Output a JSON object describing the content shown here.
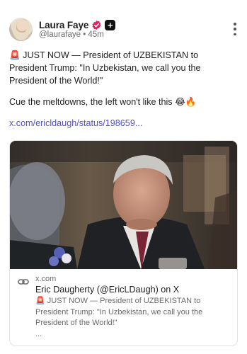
{
  "author": {
    "name": "Laura Faye",
    "handle": "@laurafaye",
    "separator": "•",
    "time": "45m"
  },
  "post": {
    "line1": "🚨 JUST NOW — President of UZBEKISTAN to President Trump: \"In Uzbekistan, we call you the President of the World!\"",
    "line2": "Cue the meltdowns, the left won't like this 😂🔥",
    "link": "x.com/ericldaugh/status/198659..."
  },
  "card": {
    "domain": "x.com",
    "title": "Eric Daugherty (@EricLDaugh) on X",
    "description": "🚨 JUST NOW — President of UZBEKISTAN to President Trump: \"In Uzbekistan, we call you the President of the World!\"",
    "ellipsis": "..."
  },
  "colors": {
    "link": "#4f4fd0",
    "verified_badge": "#e0245e",
    "text": "#1f1f1f",
    "muted": "#6b6b6b"
  },
  "icons": [
    "verified-badge-icon",
    "plus-badge-icon",
    "more-options-icon",
    "link-chain-icon"
  ]
}
